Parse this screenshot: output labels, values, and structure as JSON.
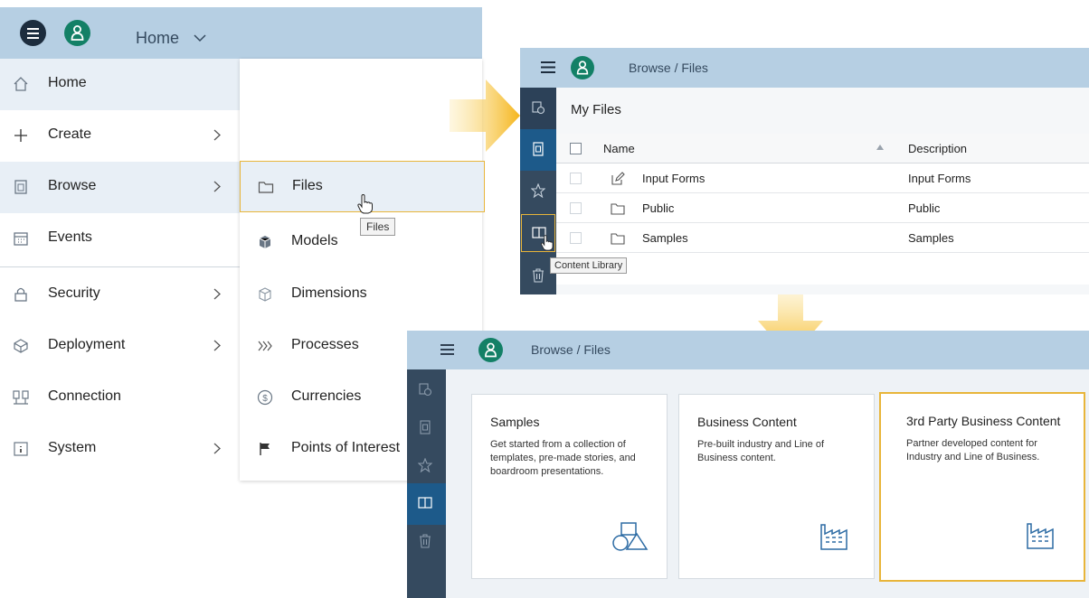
{
  "panel1": {
    "header_title": "Home",
    "menu": [
      {
        "label": "Home",
        "icon": "home-icon",
        "has_submenu": false
      },
      {
        "label": "Create",
        "icon": "plus-icon",
        "has_submenu": true
      },
      {
        "label": "Browse",
        "icon": "browse-icon",
        "has_submenu": true
      },
      {
        "label": "Events",
        "icon": "calendar-icon",
        "has_submenu": false
      },
      {
        "label": "Security",
        "icon": "lock-icon",
        "has_submenu": true
      },
      {
        "label": "Deployment",
        "icon": "deployment-icon",
        "has_submenu": true
      },
      {
        "label": "Connection",
        "icon": "connection-icon",
        "has_submenu": false
      },
      {
        "label": "System",
        "icon": "system-icon",
        "has_submenu": true
      }
    ],
    "submenu": [
      {
        "label": "Files",
        "icon": "folder-icon"
      },
      {
        "label": "Models",
        "icon": "models-icon"
      },
      {
        "label": "Dimensions",
        "icon": "dimensions-icon"
      },
      {
        "label": "Processes",
        "icon": "processes-icon"
      },
      {
        "label": "Currencies",
        "icon": "currency-icon"
      },
      {
        "label": "Points of Interest",
        "icon": "flag-icon"
      }
    ],
    "tooltip": "Files"
  },
  "panel2": {
    "breadcrumb": "Browse / Files",
    "page_title": "My Files",
    "columns": [
      "Name",
      "Description"
    ],
    "rows": [
      {
        "name": "Input Forms",
        "description": "Input Forms",
        "icon": "edit-form-icon"
      },
      {
        "name": "Public",
        "description": "Public",
        "icon": "folder-icon"
      },
      {
        "name": "Samples",
        "description": "Samples",
        "icon": "folder-icon"
      }
    ],
    "rail_tooltip": "Content Library"
  },
  "panel3": {
    "breadcrumb": "Browse / Files",
    "cards": [
      {
        "title": "Samples",
        "description": "Get started from a collection of templates, pre-made stories, and boardroom presentations.",
        "icon": "shapes-icon"
      },
      {
        "title": "Business Content",
        "description": "Pre-built industry and Line of Business content.",
        "icon": "factory-icon"
      },
      {
        "title": "3rd Party Business Content",
        "description": "Partner developed content for Industry and Line of Business.",
        "icon": "factory-icon"
      }
    ]
  },
  "colors": {
    "header": "#b6cfe3",
    "shell_dark": "#1d2d3e",
    "avatar": "#138066",
    "rail": "#354a5f",
    "highlight": "#e8b53a",
    "arrow": "#f5b51b"
  }
}
